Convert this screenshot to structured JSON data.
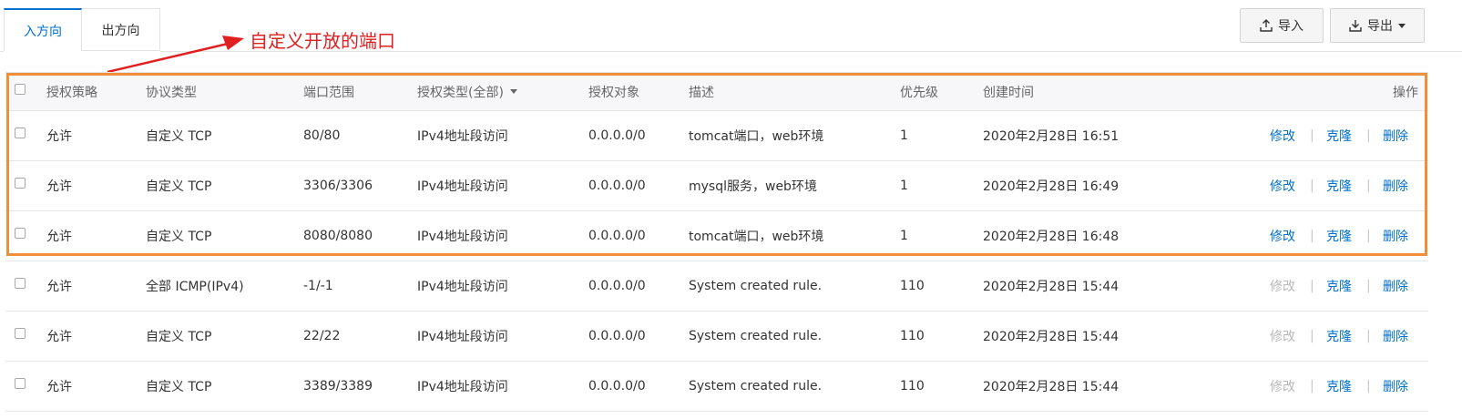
{
  "tabs": [
    {
      "label": "入方向",
      "active": true
    },
    {
      "label": "出方向",
      "active": false
    }
  ],
  "toolbar": {
    "import_label": "导入",
    "export_label": "导出"
  },
  "annotation": {
    "text": "自定义开放的端口",
    "color": "#e02020"
  },
  "table": {
    "headers": {
      "policy": "授权策略",
      "protocol": "协议类型",
      "port": "端口范围",
      "auth_type": "授权类型(全部)",
      "target": "授权对象",
      "desc": "描述",
      "priority": "优先级",
      "created": "创建时间",
      "actions": "操作"
    },
    "action_labels": {
      "edit": "修改",
      "clone": "克隆",
      "delete": "删除",
      "separator": "|"
    },
    "rows": [
      {
        "policy": "允许",
        "protocol": "自定义 TCP",
        "port": "80/80",
        "auth_type": "IPv4地址段访问",
        "target": "0.0.0.0/0",
        "desc": "tomcat端口，web环境",
        "priority": "1",
        "created": "2020年2月28日 16:51",
        "edit_enabled": true
      },
      {
        "policy": "允许",
        "protocol": "自定义 TCP",
        "port": "3306/3306",
        "auth_type": "IPv4地址段访问",
        "target": "0.0.0.0/0",
        "desc": "mysql服务，web环境",
        "priority": "1",
        "created": "2020年2月28日 16:49",
        "edit_enabled": true
      },
      {
        "policy": "允许",
        "protocol": "自定义 TCP",
        "port": "8080/8080",
        "auth_type": "IPv4地址段访问",
        "target": "0.0.0.0/0",
        "desc": "tomcat端口，web环境",
        "priority": "1",
        "created": "2020年2月28日 16:48",
        "edit_enabled": true
      },
      {
        "policy": "允许",
        "protocol": "全部 ICMP(IPv4)",
        "port": "-1/-1",
        "auth_type": "IPv4地址段访问",
        "target": "0.0.0.0/0",
        "desc": "System created rule.",
        "priority": "110",
        "created": "2020年2月28日 15:44",
        "edit_enabled": false
      },
      {
        "policy": "允许",
        "protocol": "自定义 TCP",
        "port": "22/22",
        "auth_type": "IPv4地址段访问",
        "target": "0.0.0.0/0",
        "desc": "System created rule.",
        "priority": "110",
        "created": "2020年2月28日 15:44",
        "edit_enabled": false
      },
      {
        "policy": "允许",
        "protocol": "自定义 TCP",
        "port": "3389/3389",
        "auth_type": "IPv4地址段访问",
        "target": "0.0.0.0/0",
        "desc": "System created rule.",
        "priority": "110",
        "created": "2020年2月28日 15:44",
        "edit_enabled": false
      }
    ]
  },
  "colors": {
    "accent": "#0070cc",
    "highlight_border": "#ef8f3a",
    "disabled_action": "#b8b8b8"
  }
}
